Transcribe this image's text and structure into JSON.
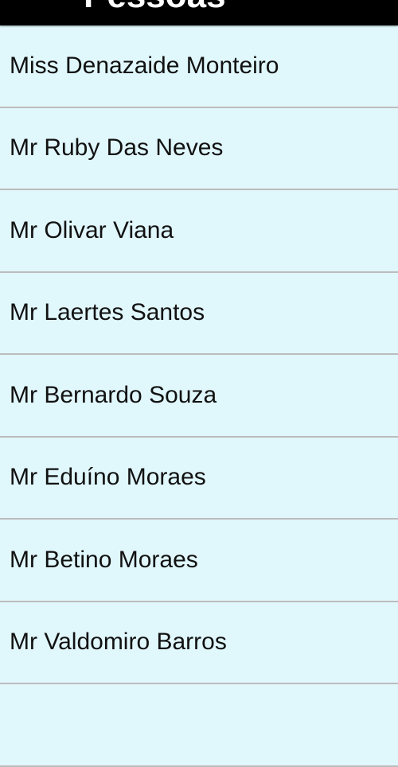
{
  "header": {
    "title": "Pessoas"
  },
  "people": [
    "Miss Denazaide Monteiro",
    "Mr Ruby Das Neves",
    "Mr Olivar Viana",
    "Mr Laertes Santos",
    "Mr Bernardo Souza",
    "Mr Eduíno Moraes",
    "Mr Betino Moraes",
    "Mr Valdomiro Barros"
  ]
}
